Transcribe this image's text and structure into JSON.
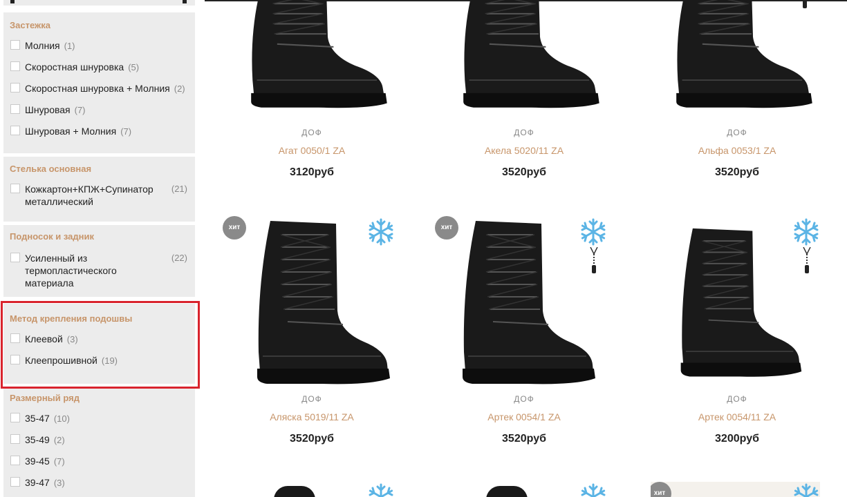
{
  "filters": {
    "fastener": {
      "title": "Застежка",
      "options": [
        {
          "label": "Молния",
          "count": "(1)"
        },
        {
          "label": "Скоростная шнуровка",
          "count": "(5)"
        },
        {
          "label": "Скоростная шнуровка + Молния",
          "count": "(2)"
        },
        {
          "label": "Шнуровая",
          "count": "(7)"
        },
        {
          "label": "Шнуровая + Молния",
          "count": "(7)"
        }
      ]
    },
    "insole": {
      "title": "Стелька основная",
      "options": [
        {
          "label": "Кожкартон+КПЖ+Супинатор металлический",
          "count": "(21)"
        }
      ]
    },
    "toecap": {
      "title": "Подносок и задник",
      "options": [
        {
          "label": "Усиленный из термопластического материала",
          "count": "(22)"
        }
      ]
    },
    "sole_method": {
      "title": "Метод крепления подошвы",
      "options": [
        {
          "label": "Клеевой",
          "count": "(3)"
        },
        {
          "label": "Клеепрошивной",
          "count": "(19)"
        }
      ]
    },
    "sizes": {
      "title": "Размерный ряд",
      "options": [
        {
          "label": "35-47",
          "count": "(10)"
        },
        {
          "label": "35-49",
          "count": "(2)"
        },
        {
          "label": "39-45",
          "count": "(7)"
        },
        {
          "label": "39-47",
          "count": "(3)"
        }
      ]
    }
  },
  "products": [
    {
      "brand": "ДОФ",
      "name": "Агат 0050/1 ZA",
      "price": "3120руб"
    },
    {
      "brand": "ДОФ",
      "name": "Акела 5020/11 ZA",
      "price": "3520руб"
    },
    {
      "brand": "ДОФ",
      "name": "Альфа 0053/1 ZA",
      "price": "3520руб"
    },
    {
      "brand": "ДОФ",
      "name": "Аляска 5019/11 ZA",
      "price": "3520руб"
    },
    {
      "brand": "ДОФ",
      "name": "Артек 0054/1 ZA",
      "price": "3520руб"
    },
    {
      "brand": "ДОФ",
      "name": "Артек 0054/11 ZA",
      "price": "3200руб"
    }
  ],
  "badges": {
    "hit": "хит"
  },
  "icons": {
    "winter": "snowflake-icon",
    "zipper": "zipper-icon"
  },
  "colors": {
    "accent": "#c7956a",
    "highlight": "#d9232d",
    "badge": "#8a8a8a",
    "snowflake": "#5bb4e5"
  }
}
